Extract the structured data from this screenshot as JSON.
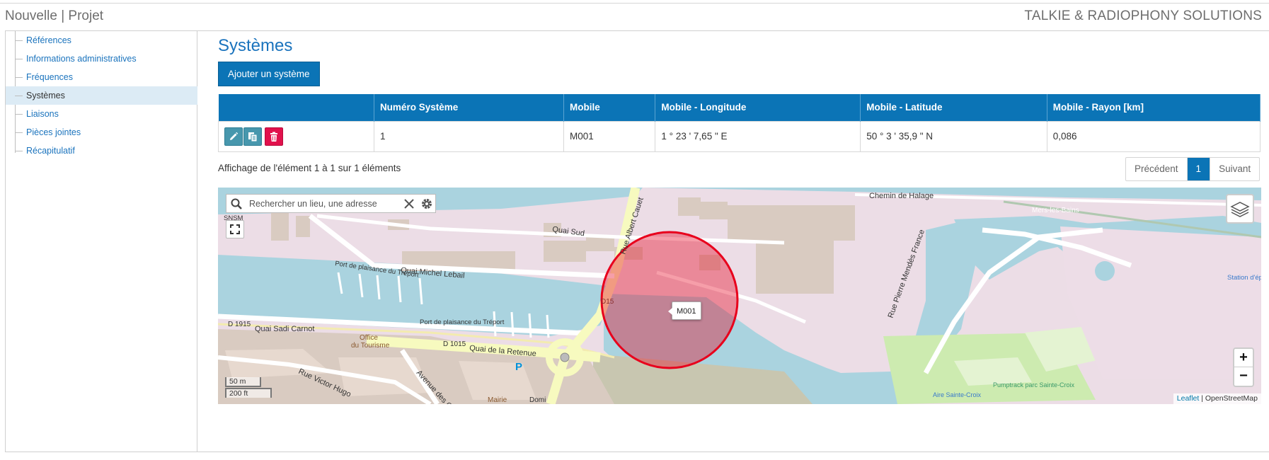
{
  "header": {
    "app_title": "Nouvelle | Projet",
    "brand": "TALKIE & RADIOPHONY SOLUTIONS"
  },
  "sidebar": {
    "items": [
      {
        "label": "Références",
        "active": false
      },
      {
        "label": "Informations administratives",
        "active": false
      },
      {
        "label": "Fréquences",
        "active": false
      },
      {
        "label": "Systèmes",
        "active": true
      },
      {
        "label": "Liaisons",
        "active": false
      },
      {
        "label": "Pièces jointes",
        "active": false
      },
      {
        "label": "Récapitulatif",
        "active": false
      }
    ]
  },
  "main": {
    "title": "Systèmes",
    "add_button": "Ajouter un système",
    "table": {
      "columns": [
        "",
        "Numéro Système",
        "Mobile",
        "Mobile - Longitude",
        "Mobile - Latitude",
        "Mobile - Rayon [km]"
      ],
      "rows": [
        {
          "numero": "1",
          "mobile": "M001",
          "longitude": "1 ° 23 ' 7,65 \" E",
          "latitude": "50 ° 3 ' 35,9 \" N",
          "rayon": "0,086"
        }
      ],
      "row_actions": [
        "edit-icon",
        "copy-icon",
        "trash-icon"
      ]
    },
    "info": "Affichage de l'élément 1 à 1 sur 1 éléments",
    "pager": {
      "prev": "Précédent",
      "current": "1",
      "next": "Suivant"
    }
  },
  "map": {
    "search_placeholder": "Rechercher un lieu, une adresse",
    "marker_label": "M001",
    "zoom_in": "+",
    "zoom_out": "−",
    "scale_metric": "50 m",
    "scale_imperial": "200 ft",
    "attribution_leaflet": "Leaflet",
    "attribution_sep": " | ",
    "attribution_osm": "OpenStreetMap",
    "labels": {
      "chemin_halage": "Chemin de Halage",
      "mers_bains": "Mers-les-Bains",
      "quai_sud": "Quai Sud",
      "rue_albert_cauet": "Rue Albert Cauet",
      "quai_michel_lebail": "Quai Michel Lebail",
      "port_plaisance_1": "Port de plaisance du Tréport",
      "port_plaisance_2": "Port de plaisance du Tréport",
      "d1915": "D 1915",
      "quai_sadi_carnot": "Quai Sadi Carnot",
      "office": "Office",
      "du_tourisme": "du Tourisme",
      "d1015": "D 1015",
      "quai_retenue": "Quai de la Retenue",
      "rue_victor_hugo": "Rue Victor Hugo",
      "avenue_canaux": "Avenue des Canaux",
      "mairie": "Mairie",
      "rue_pierre_mendes": "Rue Pierre Mendès France",
      "snsm": "SNSM",
      "pumptrack": "Pumptrack parc Sainte-Croix",
      "aire": "Aire Sainte-Croix",
      "station": "Station d'épuration de Le Tréport",
      "d15": "D15",
      "domi": "Domi",
      "p": "P"
    },
    "circle_color": "#e8001c"
  }
}
